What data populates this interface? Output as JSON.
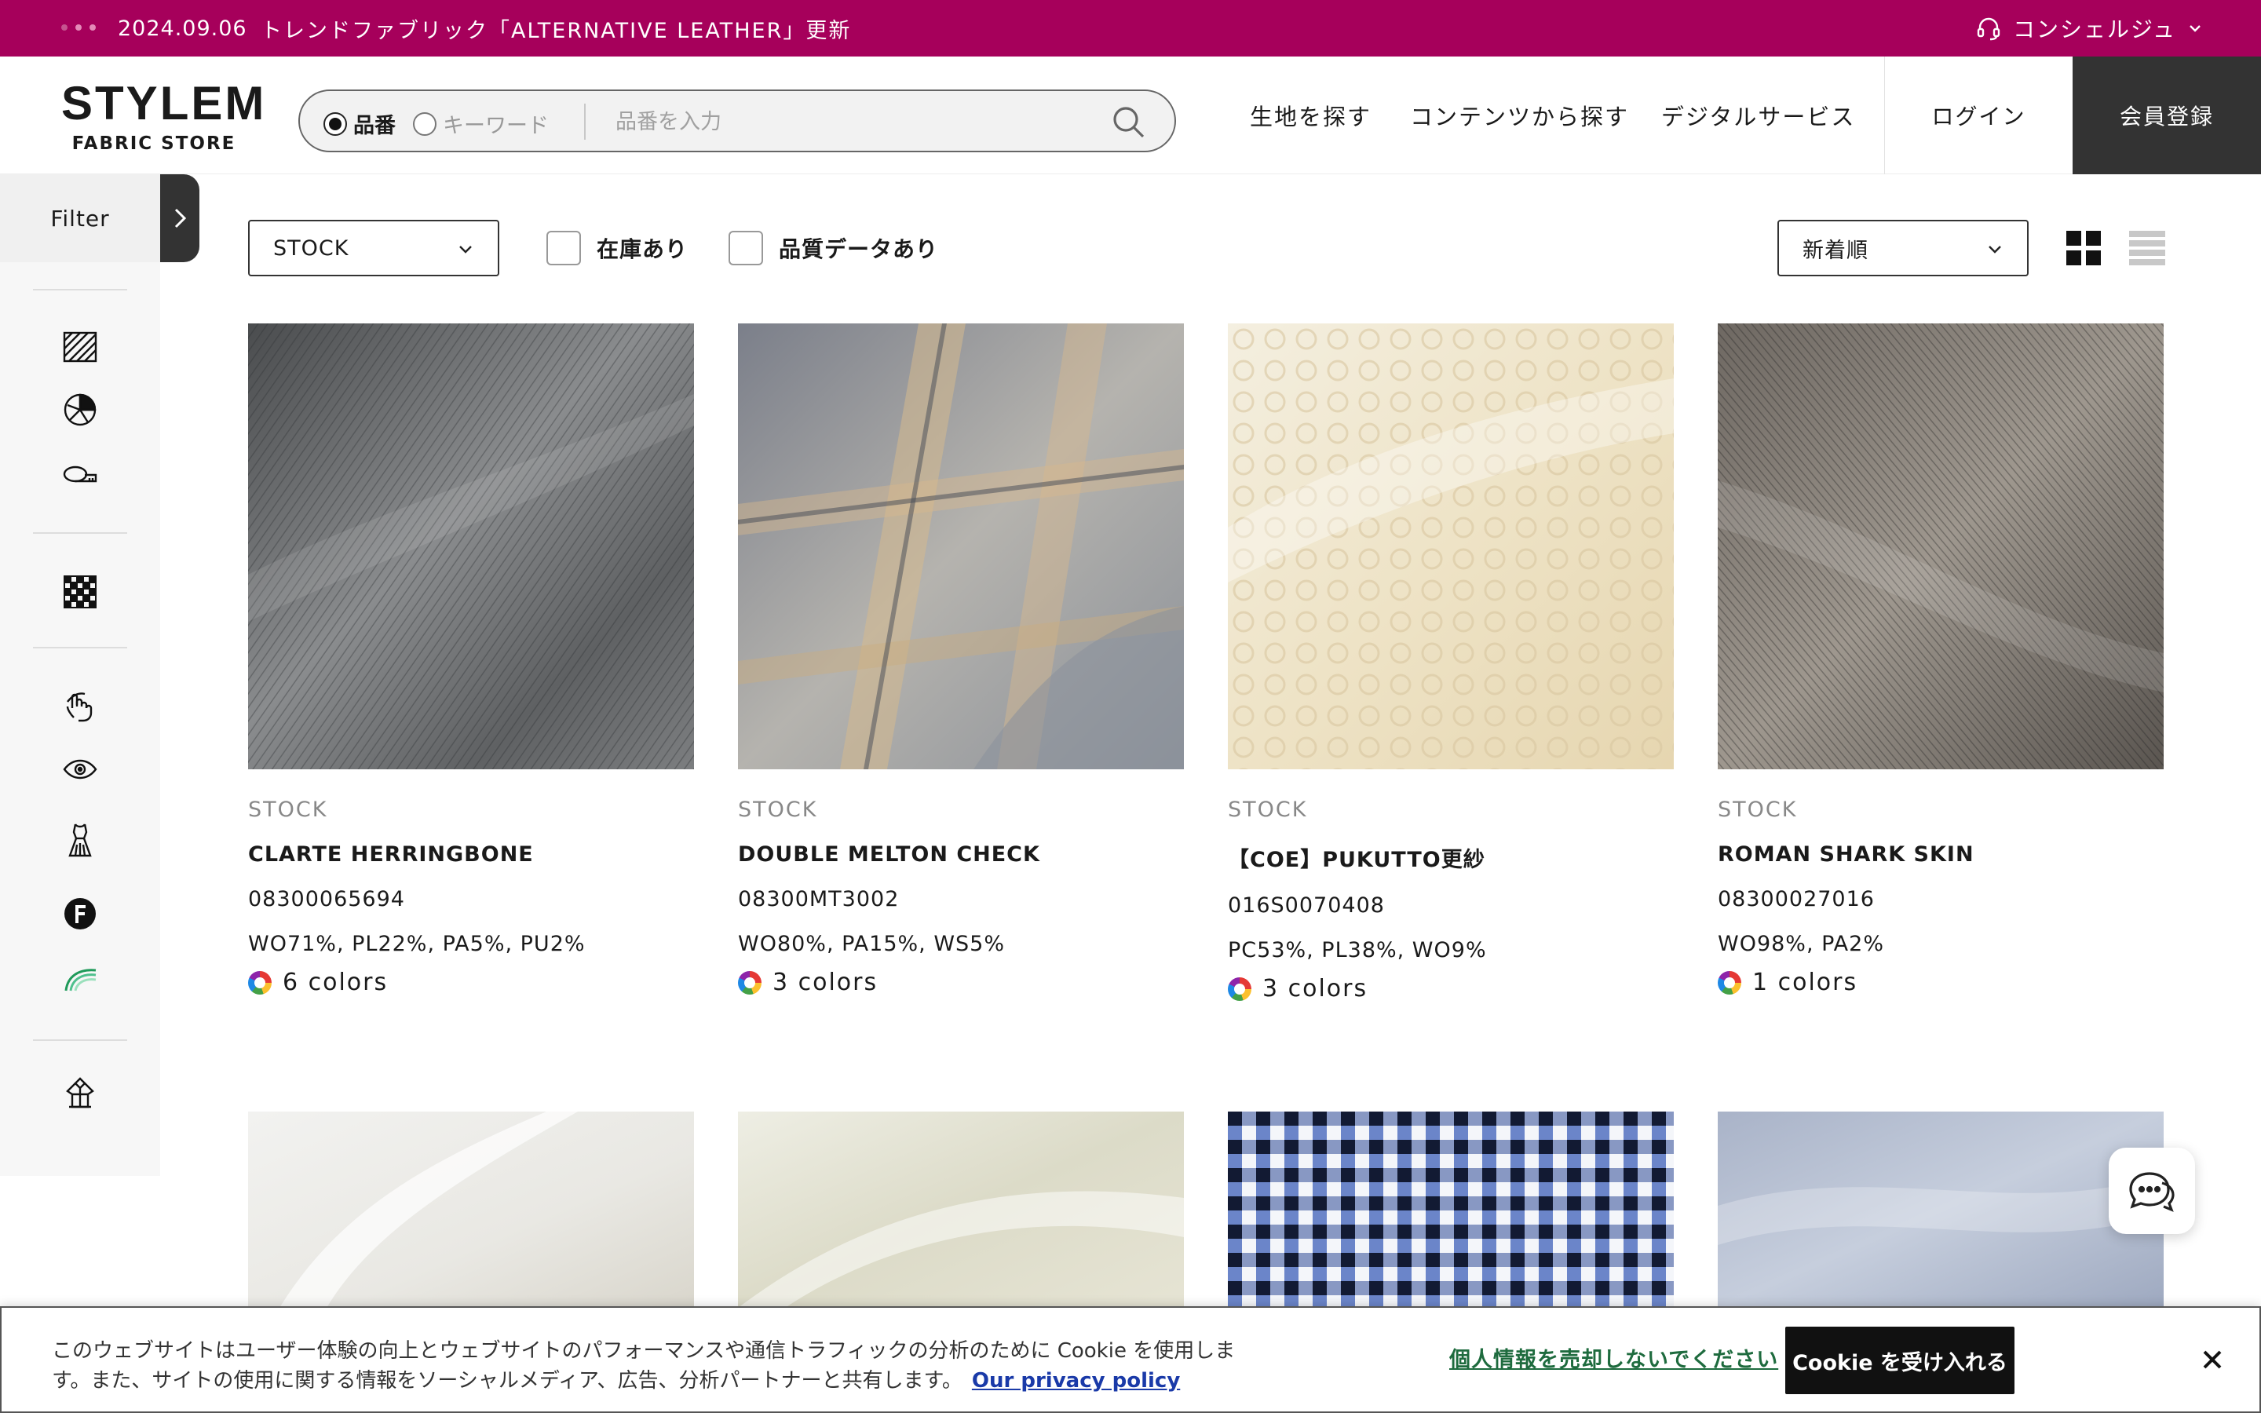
{
  "announcement": {
    "date": "2024.09.06",
    "message": "トレンドファブリック「ALTERNATIVE LEATHER」更新",
    "concierge_label": "コンシェルジュ"
  },
  "header": {
    "logo_main": "STYLEM",
    "logo_sub": "FABRIC STORE",
    "search": {
      "mode_part_number": "品番",
      "mode_keyword": "キーワード",
      "placeholder": "品番を入力",
      "value": ""
    },
    "nav": [
      "生地を探す",
      "コンテンツから探す",
      "デジタルサービス"
    ],
    "login_label": "ログイン",
    "register_label": "会員登録"
  },
  "sidebar": {
    "filter_label": "Filter"
  },
  "toolbar": {
    "category_select": "STOCK",
    "in_stock_label": "在庫あり",
    "quality_data_label": "品質データあり",
    "sort_select": "新着順"
  },
  "products": [
    {
      "category": "STOCK",
      "name": "CLARTE HERRINGBONE",
      "code": "08300065694",
      "composition": "WO71%, PL22%, PA5%, PU2%",
      "colors": "6 colors"
    },
    {
      "category": "STOCK",
      "name": "DOUBLE MELTON CHECK",
      "code": "08300MT3002",
      "composition": "WO80%, PA15%, WS5%",
      "colors": "3 colors"
    },
    {
      "category": "STOCK",
      "name": "【COE】PUKUTTO更紗",
      "code": "016S0070408",
      "composition": "PC53%, PL38%, WO9%",
      "colors": "3 colors"
    },
    {
      "category": "STOCK",
      "name": "ROMAN SHARK SKIN",
      "code": "08300027016",
      "composition": "WO98%, PA2%",
      "colors": "1 colors"
    }
  ],
  "cookie": {
    "text": "このウェブサイトはユーザー体験の向上とウェブサイトのパフォーマンスや通信トラフィックの分析のために Cookie を使用します。また、サイトの使用に関する情報をソーシャルメディア、広告、分析パートナーと共有します。",
    "privacy_link": "Our privacy policy",
    "do_not_sell": "個人情報を売却しないでください",
    "accept": "Cookie を受け入れる"
  },
  "colors": {
    "brand": "#a6005b",
    "dark": "#333333"
  },
  "icons": [
    "headset-icon",
    "chevron-down-icon",
    "search-icon",
    "chevron-right-icon",
    "fabric-texture-icon",
    "pie-chart-icon",
    "measuring-tape-icon",
    "check-pattern-icon",
    "hand-touch-icon",
    "eye-icon",
    "dress-icon",
    "f-badge-icon",
    "swoosh-icon",
    "garment-icon",
    "grid-view-icon",
    "list-view-icon",
    "chat-icon",
    "close-icon",
    "color-ring-icon"
  ]
}
